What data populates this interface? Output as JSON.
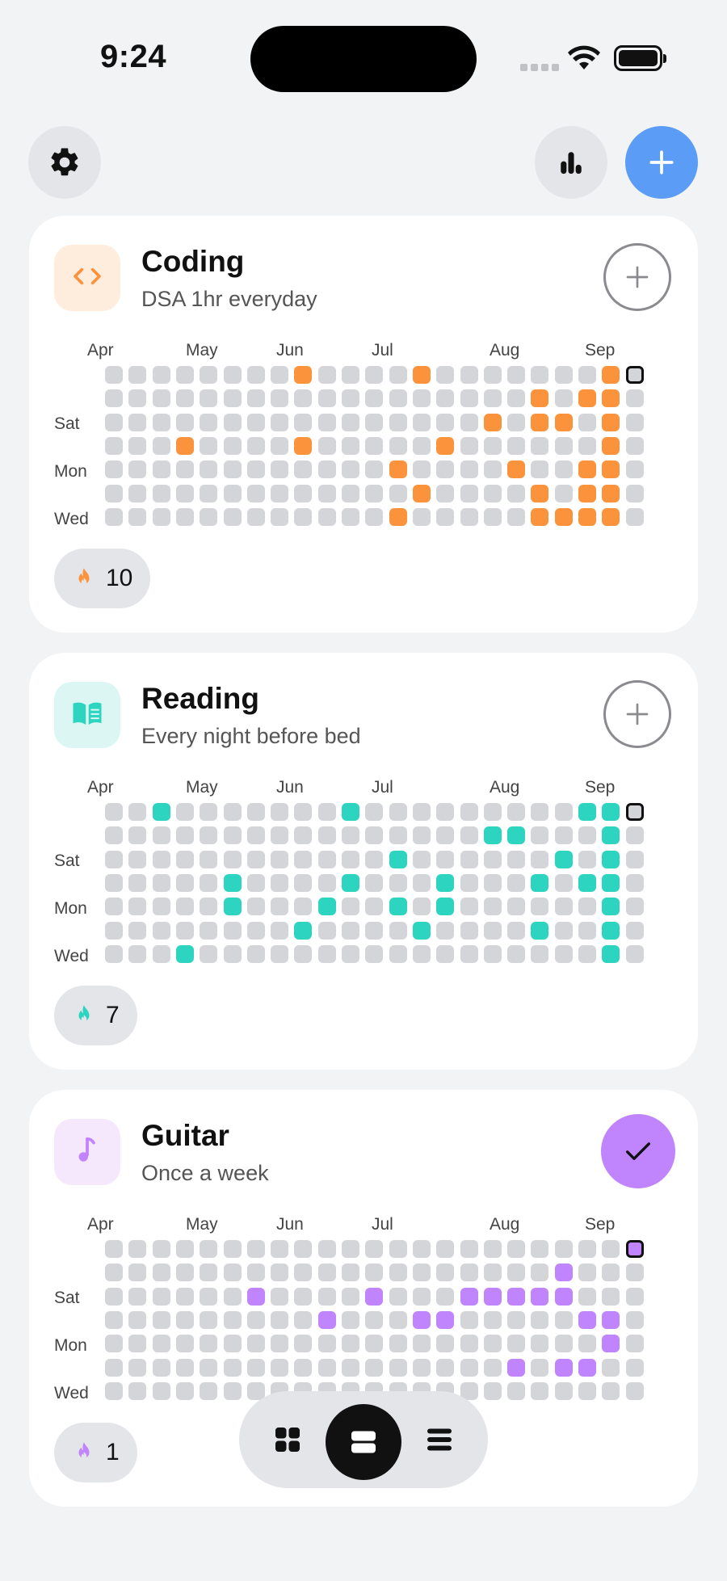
{
  "status_bar": {
    "time": "9:24"
  },
  "top_bar": {
    "settings_icon": "gear-icon",
    "stats_icon": "bar-chart-icon",
    "add_icon": "plus-icon",
    "add_color": "#5b9cf7"
  },
  "calendar": {
    "months": [
      "Apr",
      "May",
      "Jun",
      "Jul",
      "Aug",
      "Sep"
    ],
    "day_labels": [
      "Sat",
      "Mon",
      "Wed"
    ]
  },
  "habits": [
    {
      "name": "Coding",
      "description": "DSA 1hr everyday",
      "icon": "code-icon",
      "color": "#fb923c",
      "icon_bg": "#feecdc",
      "completed_today": false,
      "streak": "10",
      "filled": [
        [
          8,
          0
        ],
        [
          13,
          0
        ],
        [
          21,
          0
        ],
        [
          18,
          1
        ],
        [
          20,
          1
        ],
        [
          21,
          1
        ],
        [
          16,
          2
        ],
        [
          18,
          2
        ],
        [
          19,
          2
        ],
        [
          21,
          2
        ],
        [
          3,
          3
        ],
        [
          8,
          3
        ],
        [
          14,
          3
        ],
        [
          21,
          3
        ],
        [
          12,
          4
        ],
        [
          17,
          4
        ],
        [
          20,
          4
        ],
        [
          21,
          4
        ],
        [
          13,
          5
        ],
        [
          18,
          5
        ],
        [
          20,
          5
        ],
        [
          21,
          5
        ],
        [
          12,
          6
        ],
        [
          18,
          6
        ],
        [
          19,
          6
        ],
        [
          20,
          6
        ],
        [
          21,
          6
        ]
      ]
    },
    {
      "name": "Reading",
      "description": "Every night before bed",
      "icon": "book-icon",
      "color": "#2dd4bf",
      "icon_bg": "#dcf7f3",
      "completed_today": false,
      "streak": "7",
      "filled": [
        [
          2,
          0
        ],
        [
          10,
          0
        ],
        [
          20,
          0
        ],
        [
          21,
          0
        ],
        [
          16,
          1
        ],
        [
          17,
          1
        ],
        [
          21,
          1
        ],
        [
          12,
          2
        ],
        [
          19,
          2
        ],
        [
          21,
          2
        ],
        [
          5,
          3
        ],
        [
          10,
          3
        ],
        [
          14,
          3
        ],
        [
          18,
          3
        ],
        [
          20,
          3
        ],
        [
          21,
          3
        ],
        [
          5,
          4
        ],
        [
          9,
          4
        ],
        [
          12,
          4
        ],
        [
          14,
          4
        ],
        [
          21,
          4
        ],
        [
          8,
          5
        ],
        [
          13,
          5
        ],
        [
          18,
          5
        ],
        [
          21,
          5
        ],
        [
          3,
          6
        ],
        [
          21,
          6
        ]
      ]
    },
    {
      "name": "Guitar",
      "description": "Once a week",
      "icon": "music-note-icon",
      "color": "#c084fc",
      "icon_bg": "#f5e8fd",
      "completed_today": true,
      "streak": "1",
      "filled": [
        [
          22,
          0
        ],
        [
          19,
          1
        ],
        [
          6,
          2
        ],
        [
          11,
          2
        ],
        [
          15,
          2
        ],
        [
          16,
          2
        ],
        [
          17,
          2
        ],
        [
          18,
          2
        ],
        [
          19,
          2
        ],
        [
          9,
          3
        ],
        [
          13,
          3
        ],
        [
          14,
          3
        ],
        [
          20,
          3
        ],
        [
          21,
          3
        ],
        [
          21,
          4
        ],
        [
          17,
          5
        ],
        [
          19,
          5
        ],
        [
          20,
          5
        ]
      ]
    }
  ],
  "bottom_nav": {
    "items": [
      "grid-view-icon",
      "card-view-icon",
      "list-view-icon"
    ],
    "active": "card-view-icon"
  }
}
